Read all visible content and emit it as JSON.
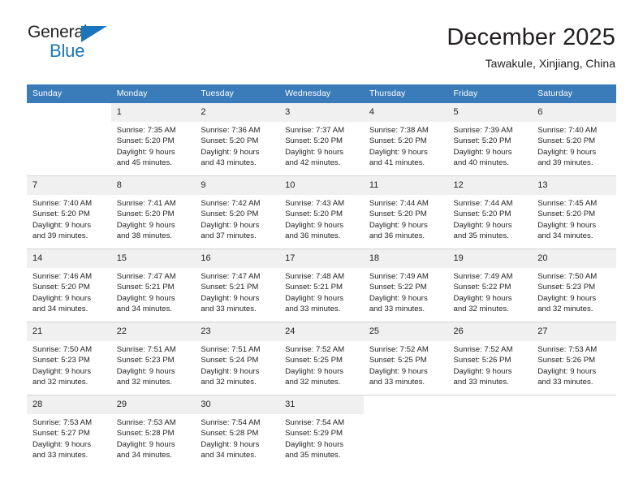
{
  "brand": {
    "name_top": "General",
    "name_bottom": "Blue",
    "triangle_color": "#1b75bb",
    "text_color": "#231f20"
  },
  "header": {
    "title": "December 2025",
    "subtitle": "Tawakule, Xinjiang, China"
  },
  "calendar": {
    "header_bg": "#3a7cb9",
    "header_text_color": "#ffffff",
    "daynum_bg": "#f0f0f0",
    "weekday_headers": [
      "Sunday",
      "Monday",
      "Tuesday",
      "Wednesday",
      "Thursday",
      "Friday",
      "Saturday"
    ],
    "weeks": [
      [
        {
          "day": "",
          "lines": []
        },
        {
          "day": "1",
          "lines": [
            "Sunrise: 7:35 AM",
            "Sunset: 5:20 PM",
            "Daylight: 9 hours",
            "and 45 minutes."
          ]
        },
        {
          "day": "2",
          "lines": [
            "Sunrise: 7:36 AM",
            "Sunset: 5:20 PM",
            "Daylight: 9 hours",
            "and 43 minutes."
          ]
        },
        {
          "day": "3",
          "lines": [
            "Sunrise: 7:37 AM",
            "Sunset: 5:20 PM",
            "Daylight: 9 hours",
            "and 42 minutes."
          ]
        },
        {
          "day": "4",
          "lines": [
            "Sunrise: 7:38 AM",
            "Sunset: 5:20 PM",
            "Daylight: 9 hours",
            "and 41 minutes."
          ]
        },
        {
          "day": "5",
          "lines": [
            "Sunrise: 7:39 AM",
            "Sunset: 5:20 PM",
            "Daylight: 9 hours",
            "and 40 minutes."
          ]
        },
        {
          "day": "6",
          "lines": [
            "Sunrise: 7:40 AM",
            "Sunset: 5:20 PM",
            "Daylight: 9 hours",
            "and 39 minutes."
          ]
        }
      ],
      [
        {
          "day": "7",
          "lines": [
            "Sunrise: 7:40 AM",
            "Sunset: 5:20 PM",
            "Daylight: 9 hours",
            "and 39 minutes."
          ]
        },
        {
          "day": "8",
          "lines": [
            "Sunrise: 7:41 AM",
            "Sunset: 5:20 PM",
            "Daylight: 9 hours",
            "and 38 minutes."
          ]
        },
        {
          "day": "9",
          "lines": [
            "Sunrise: 7:42 AM",
            "Sunset: 5:20 PM",
            "Daylight: 9 hours",
            "and 37 minutes."
          ]
        },
        {
          "day": "10",
          "lines": [
            "Sunrise: 7:43 AM",
            "Sunset: 5:20 PM",
            "Daylight: 9 hours",
            "and 36 minutes."
          ]
        },
        {
          "day": "11",
          "lines": [
            "Sunrise: 7:44 AM",
            "Sunset: 5:20 PM",
            "Daylight: 9 hours",
            "and 36 minutes."
          ]
        },
        {
          "day": "12",
          "lines": [
            "Sunrise: 7:44 AM",
            "Sunset: 5:20 PM",
            "Daylight: 9 hours",
            "and 35 minutes."
          ]
        },
        {
          "day": "13",
          "lines": [
            "Sunrise: 7:45 AM",
            "Sunset: 5:20 PM",
            "Daylight: 9 hours",
            "and 34 minutes."
          ]
        }
      ],
      [
        {
          "day": "14",
          "lines": [
            "Sunrise: 7:46 AM",
            "Sunset: 5:20 PM",
            "Daylight: 9 hours",
            "and 34 minutes."
          ]
        },
        {
          "day": "15",
          "lines": [
            "Sunrise: 7:47 AM",
            "Sunset: 5:21 PM",
            "Daylight: 9 hours",
            "and 34 minutes."
          ]
        },
        {
          "day": "16",
          "lines": [
            "Sunrise: 7:47 AM",
            "Sunset: 5:21 PM",
            "Daylight: 9 hours",
            "and 33 minutes."
          ]
        },
        {
          "day": "17",
          "lines": [
            "Sunrise: 7:48 AM",
            "Sunset: 5:21 PM",
            "Daylight: 9 hours",
            "and 33 minutes."
          ]
        },
        {
          "day": "18",
          "lines": [
            "Sunrise: 7:49 AM",
            "Sunset: 5:22 PM",
            "Daylight: 9 hours",
            "and 33 minutes."
          ]
        },
        {
          "day": "19",
          "lines": [
            "Sunrise: 7:49 AM",
            "Sunset: 5:22 PM",
            "Daylight: 9 hours",
            "and 32 minutes."
          ]
        },
        {
          "day": "20",
          "lines": [
            "Sunrise: 7:50 AM",
            "Sunset: 5:23 PM",
            "Daylight: 9 hours",
            "and 32 minutes."
          ]
        }
      ],
      [
        {
          "day": "21",
          "lines": [
            "Sunrise: 7:50 AM",
            "Sunset: 5:23 PM",
            "Daylight: 9 hours",
            "and 32 minutes."
          ]
        },
        {
          "day": "22",
          "lines": [
            "Sunrise: 7:51 AM",
            "Sunset: 5:23 PM",
            "Daylight: 9 hours",
            "and 32 minutes."
          ]
        },
        {
          "day": "23",
          "lines": [
            "Sunrise: 7:51 AM",
            "Sunset: 5:24 PM",
            "Daylight: 9 hours",
            "and 32 minutes."
          ]
        },
        {
          "day": "24",
          "lines": [
            "Sunrise: 7:52 AM",
            "Sunset: 5:25 PM",
            "Daylight: 9 hours",
            "and 32 minutes."
          ]
        },
        {
          "day": "25",
          "lines": [
            "Sunrise: 7:52 AM",
            "Sunset: 5:25 PM",
            "Daylight: 9 hours",
            "and 33 minutes."
          ]
        },
        {
          "day": "26",
          "lines": [
            "Sunrise: 7:52 AM",
            "Sunset: 5:26 PM",
            "Daylight: 9 hours",
            "and 33 minutes."
          ]
        },
        {
          "day": "27",
          "lines": [
            "Sunrise: 7:53 AM",
            "Sunset: 5:26 PM",
            "Daylight: 9 hours",
            "and 33 minutes."
          ]
        }
      ],
      [
        {
          "day": "28",
          "lines": [
            "Sunrise: 7:53 AM",
            "Sunset: 5:27 PM",
            "Daylight: 9 hours",
            "and 33 minutes."
          ]
        },
        {
          "day": "29",
          "lines": [
            "Sunrise: 7:53 AM",
            "Sunset: 5:28 PM",
            "Daylight: 9 hours",
            "and 34 minutes."
          ]
        },
        {
          "day": "30",
          "lines": [
            "Sunrise: 7:54 AM",
            "Sunset: 5:28 PM",
            "Daylight: 9 hours",
            "and 34 minutes."
          ]
        },
        {
          "day": "31",
          "lines": [
            "Sunrise: 7:54 AM",
            "Sunset: 5:29 PM",
            "Daylight: 9 hours",
            "and 35 minutes."
          ]
        },
        {
          "day": "",
          "lines": []
        },
        {
          "day": "",
          "lines": []
        },
        {
          "day": "",
          "lines": []
        }
      ]
    ]
  }
}
